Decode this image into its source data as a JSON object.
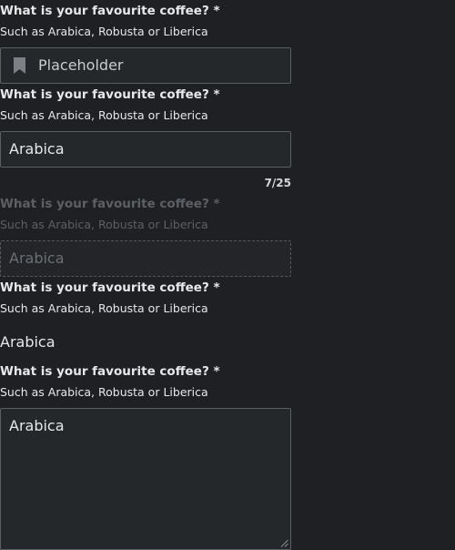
{
  "fields": {
    "icon_input": {
      "label": "What is your favourite coffee? *",
      "help": "Such as Arabica, Robusta or Liberica",
      "placeholder": "Placeholder",
      "icon": "bookmark-icon"
    },
    "counter_input": {
      "label": "What is your favourite coffee? *",
      "help": "Such as Arabica, Robusta or Liberica",
      "value": "Arabica",
      "counter": "7/25"
    },
    "disabled_input": {
      "label": "What is your favourite coffee? *",
      "help": "Such as Arabica, Robusta or Liberica",
      "value": "Arabica"
    },
    "readonly_field": {
      "label": "What is your favourite coffee? *",
      "help": "Such as Arabica, Robusta or Liberica",
      "value": "Arabica"
    },
    "textarea_field": {
      "label": "What is your favourite coffee? *",
      "help": "Such as Arabica, Robusta or Liberica",
      "value": "Arabica"
    }
  },
  "colors": {
    "background": "#1e2023",
    "input_background": "#25282b",
    "border": "#5b5f64",
    "text": "#e6e8ea",
    "disabled_text": "#5c6065"
  }
}
